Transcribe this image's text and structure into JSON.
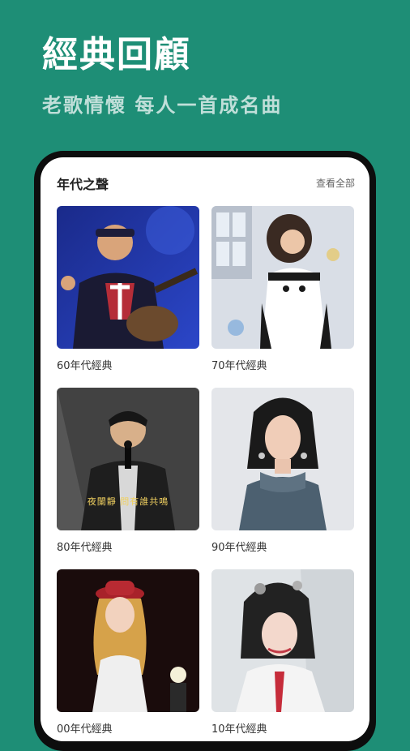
{
  "hero": {
    "title": "經典回顧",
    "subtitle": "老歌情懷 每人一首成名曲"
  },
  "section": {
    "title": "年代之聲",
    "more_label": "查看全部"
  },
  "cards": [
    {
      "label": "60年代經典"
    },
    {
      "label": "70年代經典"
    },
    {
      "label": "80年代經典",
      "subtitle_overlay": "夜闌靜  問有誰共鳴"
    },
    {
      "label": "90年代經典"
    },
    {
      "label": "00年代經典"
    },
    {
      "label": "10年代經典"
    }
  ],
  "colors": {
    "background": "#1e8e76",
    "card_bg": "#ffffff"
  }
}
